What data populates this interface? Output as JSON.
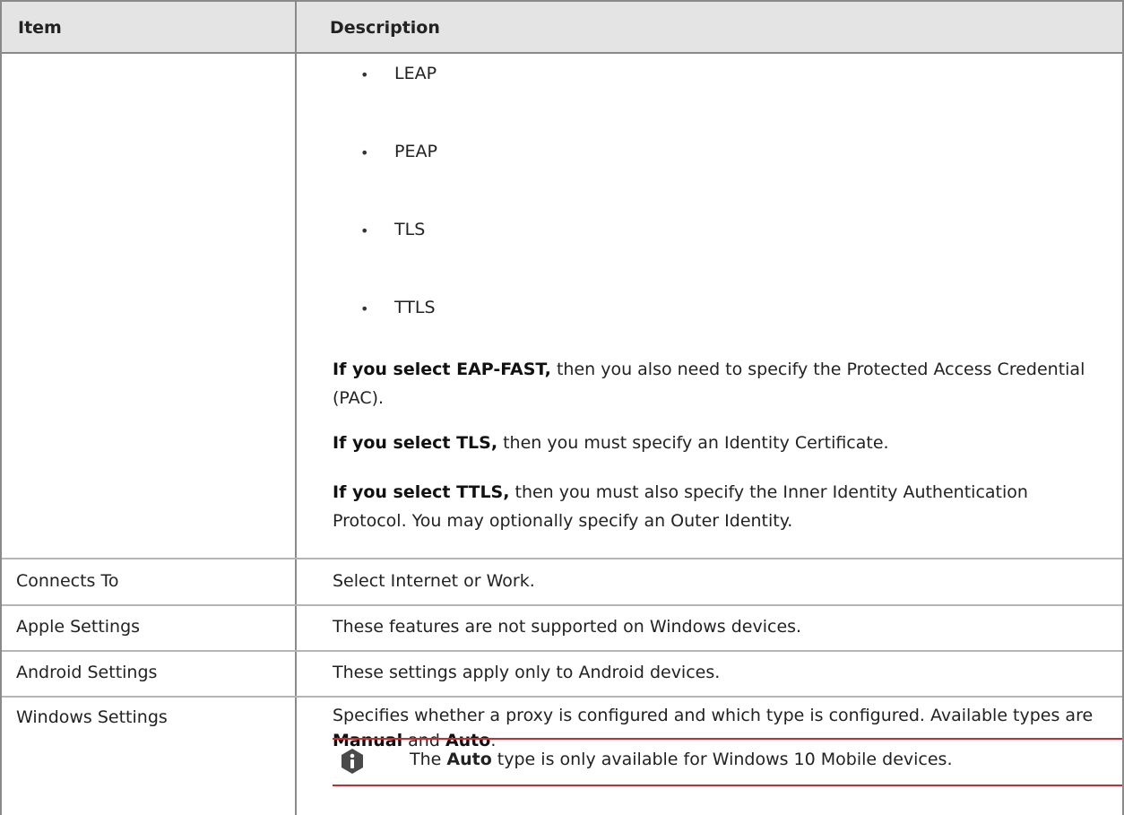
{
  "header": {
    "item_label": "Item",
    "description_label": "Description"
  },
  "bullets": [
    "LEAP",
    "PEAP",
    "TLS",
    "TTLS"
  ],
  "paragraphs": {
    "eap_fast": {
      "bold": "If you select EAP-FAST,",
      "rest": " then you also need to specify the Protected Access Credential (PAC)."
    },
    "tls": {
      "bold": "If you select TLS,",
      "rest": " then you must specify an Identity Certificate."
    },
    "ttls": {
      "bold": "If you select TTLS,",
      "rest": " then you must also specify the Inner Identity Authentication Protocol. You may optionally specify an Outer Identity."
    }
  },
  "rows": [
    {
      "item": "Connects To",
      "description": "Select Internet or Work."
    },
    {
      "item": "Apple Settings",
      "description": "These features are not supported on Windows devices."
    },
    {
      "item": "Android Settings",
      "description": "These settings apply only to Android devices."
    }
  ],
  "windows": {
    "item": "Windows Settings",
    "desc_before": "Specifies whether a proxy is configured and which type is configured. Available types are ",
    "manual": "Manual",
    "and": " and ",
    "auto": "Auto",
    "period": ".",
    "note": {
      "prefix": "The ",
      "bold": "Auto",
      "suffix": " type is only available for Windows 10 Mobile devices."
    }
  },
  "icons": {
    "note_icon": "info-icon"
  },
  "colors": {
    "header_bg": "#e4e4e4",
    "note_rule": "#d9262c",
    "icon_fill": "#4a4a4a"
  }
}
